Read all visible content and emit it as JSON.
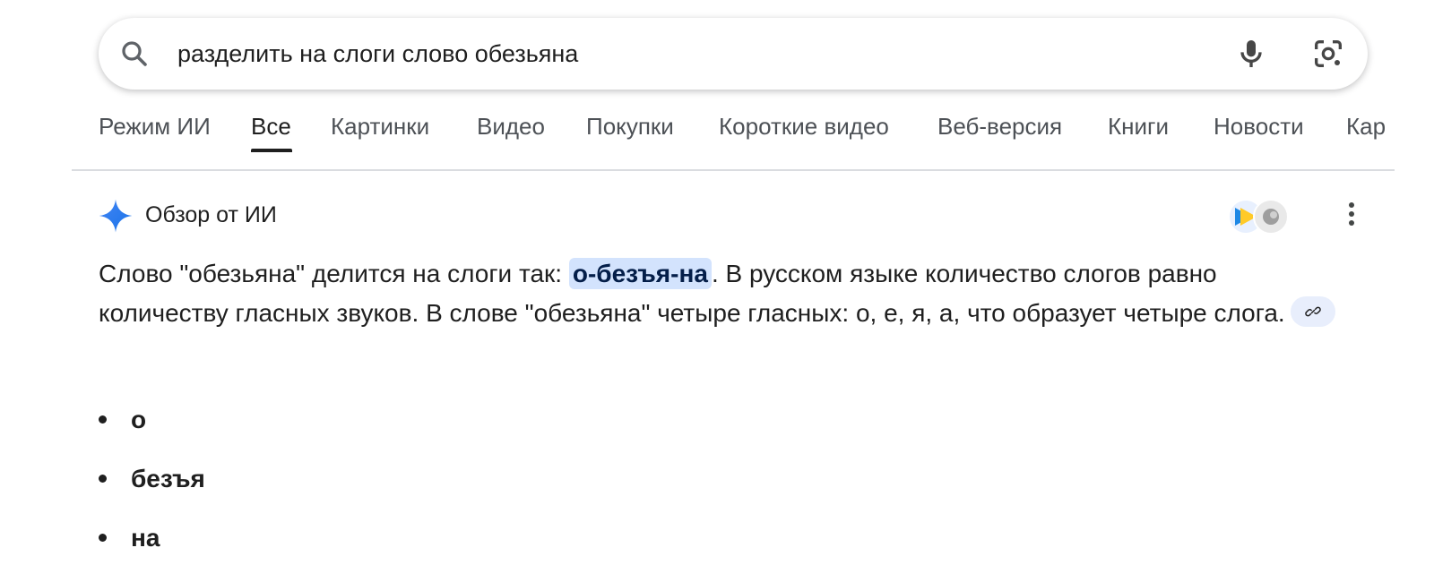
{
  "search": {
    "query": "разделить на слоги слово обезьяна",
    "icons": [
      "search-icon",
      "microphone-icon",
      "camera-lens-icon"
    ]
  },
  "tabs": [
    {
      "label": "Режим ИИ",
      "active": false
    },
    {
      "label": "Все",
      "active": true
    },
    {
      "label": "Картинки",
      "active": false
    },
    {
      "label": "Видео",
      "active": false
    },
    {
      "label": "Покупки",
      "active": false
    },
    {
      "label": "Короткие видео",
      "active": false
    },
    {
      "label": "Веб-версия",
      "active": false
    },
    {
      "label": "Книги",
      "active": false
    },
    {
      "label": "Новости",
      "active": false
    },
    {
      "label": "Кар",
      "active": false
    }
  ],
  "ai_overview": {
    "title": "Обзор от ИИ",
    "text_before": "Слово \"обезьяна\" делится на слоги так: ",
    "highlight": "о-безъя-на",
    "text_after": ". В русском языке количество слогов равно количеству гласных звуков. В слове \"обезьяна\" четыре гласных: о, е, я, а, что образует четыре слога.",
    "syllables": [
      "о",
      "безъя",
      "на"
    ]
  },
  "colors": {
    "accent_blue": "#4285f4",
    "highlight_bg": "#d3e3fd",
    "divider": "#dadce0",
    "text_secondary": "#4d5156"
  }
}
